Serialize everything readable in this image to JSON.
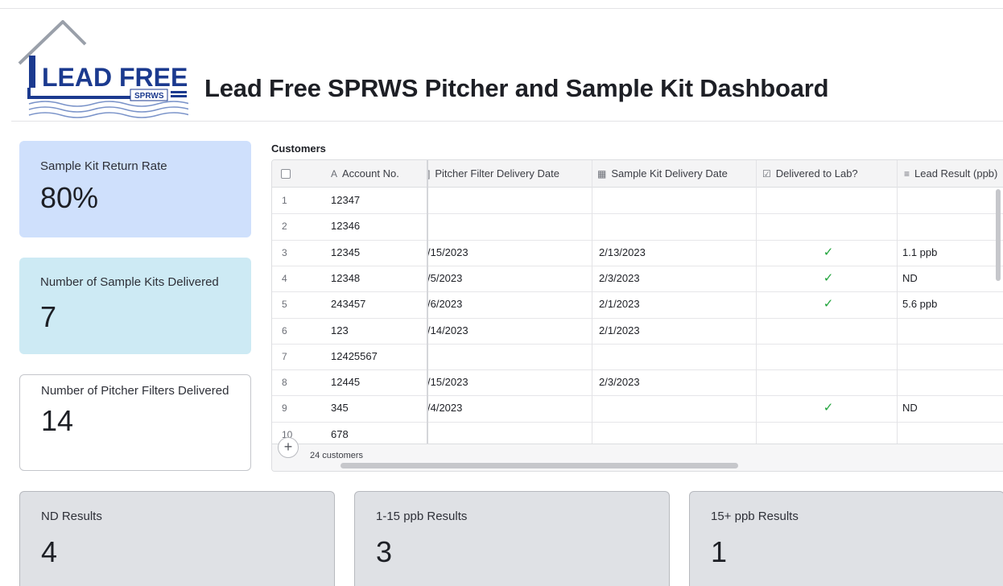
{
  "header": {
    "logo_text": "LEAD FREE",
    "logo_subtext": "SPRWS",
    "title": "Lead Free SPRWS Pitcher and Sample Kit Dashboard"
  },
  "kpis": {
    "return_rate": {
      "label": "Sample Kit Return Rate",
      "value": "80%"
    },
    "kits_delivered": {
      "label": "Number of Sample Kits Delivered",
      "value": "7"
    },
    "pitchers_delivered": {
      "label": "Number of Pitcher Filters Delivered",
      "value": "14"
    }
  },
  "result_cards": {
    "nd": {
      "label": "ND Results",
      "value": "4"
    },
    "low": {
      "label": "1-15 ppb Results",
      "value": "3"
    },
    "high": {
      "label": "15+ ppb Results",
      "value": "1"
    }
  },
  "grid": {
    "title": "Customers",
    "columns": {
      "account": "Account No.",
      "pitcher": "Pitcher Filter Delivery Date",
      "kit": "Sample Kit Delivery Date",
      "lab": "Delivered to Lab?",
      "result": "Lead Result (ppb)"
    },
    "rows": [
      {
        "num": "1",
        "account": "12347",
        "pitcher": "",
        "kit": "",
        "lab": "",
        "result": ""
      },
      {
        "num": "2",
        "account": "12346",
        "pitcher": "",
        "kit": "",
        "lab": "",
        "result": ""
      },
      {
        "num": "3",
        "account": "12345",
        "pitcher": "/15/2023",
        "kit": "2/13/2023",
        "lab": "✓",
        "result": "1.1 ppb"
      },
      {
        "num": "4",
        "account": "12348",
        "pitcher": "/5/2023",
        "kit": "2/3/2023",
        "lab": "✓",
        "result": "ND"
      },
      {
        "num": "5",
        "account": "243457",
        "pitcher": "/6/2023",
        "kit": "2/1/2023",
        "lab": "✓",
        "result": "5.6 ppb"
      },
      {
        "num": "6",
        "account": "123",
        "pitcher": "/14/2023",
        "kit": "2/1/2023",
        "lab": "",
        "result": ""
      },
      {
        "num": "7",
        "account": "12425567",
        "pitcher": "",
        "kit": "",
        "lab": "",
        "result": ""
      },
      {
        "num": "8",
        "account": "12445",
        "pitcher": "/15/2023",
        "kit": "2/3/2023",
        "lab": "",
        "result": ""
      },
      {
        "num": "9",
        "account": "345",
        "pitcher": "/4/2023",
        "kit": "",
        "lab": "✓",
        "result": "ND"
      },
      {
        "num": "10",
        "account": "678",
        "pitcher": "",
        "kit": "",
        "lab": "",
        "result": ""
      }
    ],
    "count_label": "24 customers",
    "add_symbol": "+"
  }
}
